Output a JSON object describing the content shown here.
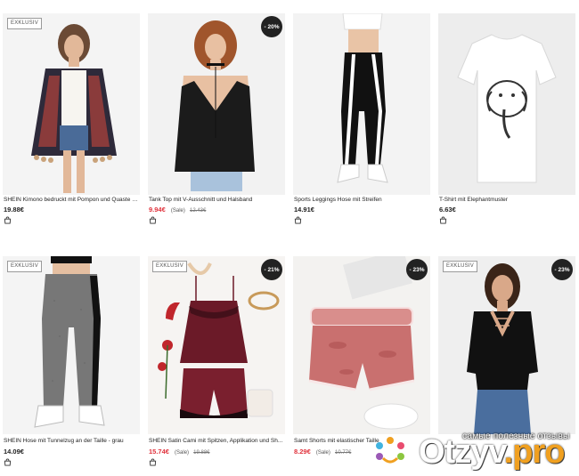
{
  "products": [
    {
      "title": "SHEIN Kimono bedruckt mit Pompon und Quaste a...",
      "price": "19.88€",
      "badge_exclusive": "EXKLUSIV",
      "discount": "",
      "sale_label": "",
      "old_price": ""
    },
    {
      "title": "Tank Top mit V-Ausschnitt und Halsband",
      "price": "9.94€",
      "badge_exclusive": "",
      "discount": "- 20%",
      "sale_label": "(Sale)",
      "old_price": "12.43€"
    },
    {
      "title": "Sports Leggings Hose mit Streifen",
      "price": "14.91€",
      "badge_exclusive": "",
      "discount": "",
      "sale_label": "",
      "old_price": ""
    },
    {
      "title": "T-Shirt mit Elephantmuster",
      "price": "6.63€",
      "badge_exclusive": "",
      "discount": "",
      "sale_label": "",
      "old_price": ""
    },
    {
      "title": "SHEIN Hose mit Tunnelzug an der Taille - grau",
      "price": "14.09€",
      "badge_exclusive": "EXKLUSIV",
      "discount": "",
      "sale_label": "",
      "old_price": ""
    },
    {
      "title": "SHEIN Satin Cami mit Spitzen, Applikation und Sh...",
      "price": "15.74€",
      "badge_exclusive": "EXKLUSIV",
      "discount": "- 21%",
      "sale_label": "(Sale)",
      "old_price": "19.88€"
    },
    {
      "title": "Samt Shorts mit elastischer Taille",
      "price": "8.29€",
      "badge_exclusive": "",
      "discount": "- 23%",
      "sale_label": "(Sale)",
      "old_price": "10.77€"
    },
    {
      "title": "",
      "price": "",
      "badge_exclusive": "EXKLUSIV",
      "discount": "- 23%",
      "sale_label": "",
      "old_price": ""
    }
  ],
  "icons": {
    "cart": "shopping-bag-icon"
  },
  "colors": {
    "sale_price": "#e0323c",
    "badge_bg": "#222222",
    "watermark_accent": "#f0a020"
  },
  "watermark": {
    "tagline": "самые полезные отзывы",
    "brand": "Otzyv",
    "brand_suffix": ".pro"
  }
}
